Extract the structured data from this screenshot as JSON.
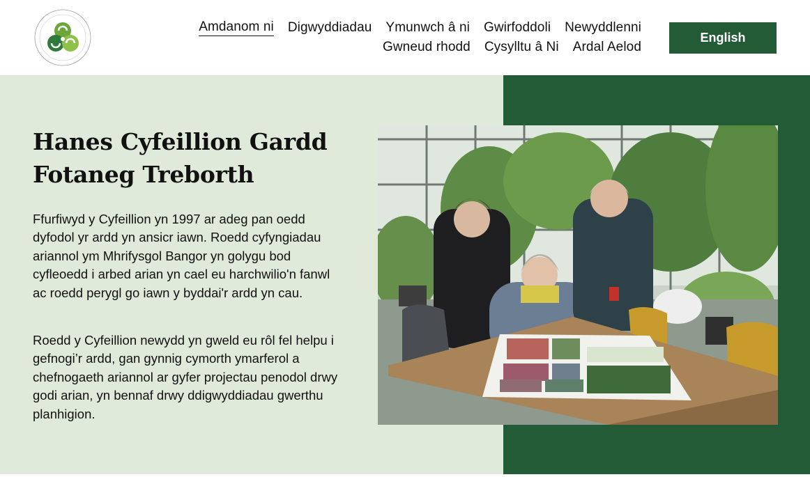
{
  "header": {
    "logo": {
      "icon": "triskele-logo-icon",
      "ring_text": "Friends of Treborth Botanic Garden · Cyfeillion Gardd Fotaneg Treborth"
    },
    "nav": {
      "row1": [
        {
          "label": "Amdanom ni",
          "active": true
        },
        {
          "label": "Digwyddiadau"
        },
        {
          "label": "Ymunwch â ni"
        },
        {
          "label": "Gwirfoddoli"
        },
        {
          "label": "Newyddlenni"
        }
      ],
      "row2": [
        {
          "label": "Gwneud rhodd"
        },
        {
          "label": "Cysylltu â Ni"
        },
        {
          "label": "Ardal Aelod"
        }
      ]
    },
    "language_button": "English"
  },
  "hero": {
    "title_line1": "Hanes Cyfeillion Gardd",
    "title_line2": "Fotaneg Treborth",
    "paragraph1": "Ffurfiwyd y Cyfeillion yn 1997 ar adeg pan oedd dyfodol yr ardd yn ansicr iawn. Roedd cyfyngiadau ariannol ym Mhrifysgol Bangor yn golygu bod cyfleoedd i arbed arian yn cael eu harchwilio'n fanwl ac roedd perygl go iawn y byddai'r ardd yn cau.",
    "paragraph2": "Roedd y Cyfeillion newydd yn gweld eu rôl fel helpu i gefnogi’r ardd, gan gynnig cymorth ymarferol a chefnogaeth ariannol ar gyfer projectau penodol drwy godi arian, yn bennaf drwy ddigwyddiadau gwerthu planhigion.",
    "photo_icon": "greenhouse-photo"
  },
  "colors": {
    "brand_green": "#245b37",
    "pale_green": "#e0eadb"
  }
}
